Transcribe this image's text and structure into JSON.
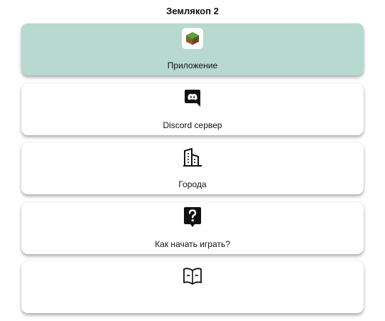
{
  "header": {
    "title": "Землякоп 2"
  },
  "menu": {
    "items": [
      {
        "label": "Приложение",
        "icon": "grass-block-app-icon",
        "active": true
      },
      {
        "label": "Discord сервер",
        "icon": "discord-icon",
        "active": false
      },
      {
        "label": "Города",
        "icon": "buildings-icon",
        "active": false
      },
      {
        "label": "Как начать играть?",
        "icon": "question-bubble-icon",
        "active": false
      },
      {
        "label": "",
        "icon": "open-book-icon",
        "active": false
      }
    ]
  },
  "colors": {
    "active_card": "#b8d9d0",
    "card": "#ffffff",
    "text": "#111111"
  }
}
